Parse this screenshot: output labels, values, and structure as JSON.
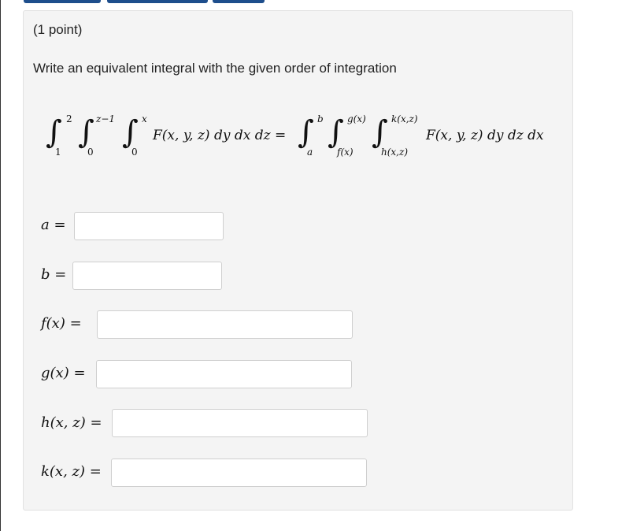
{
  "problem": {
    "points": "(1 point)",
    "prompt": "Write an equivalent integral with the given order of integration"
  },
  "equation": {
    "lhs_outer_upper": "2",
    "lhs_outer_lower": "1",
    "lhs_middle_upper": "z−1",
    "lhs_middle_lower": "0",
    "lhs_inner_upper": "x",
    "lhs_inner_lower": "0",
    "lhs_integrand": "F(x, y, z) dy dx dz =",
    "rhs_outer_upper": "b",
    "rhs_outer_lower": "a",
    "rhs_middle_upper": "g(x)",
    "rhs_middle_lower": "f(x)",
    "rhs_inner_upper": "k(x,z)",
    "rhs_inner_lower": "h(x,z)",
    "rhs_integrand": "F(x, y, z) dy dz dx"
  },
  "fields": {
    "a": {
      "label": "a =",
      "value": ""
    },
    "b": {
      "label": "b =",
      "value": ""
    },
    "f": {
      "label": "f(x) =",
      "value": ""
    },
    "g": {
      "label": "g(x) =",
      "value": ""
    },
    "h": {
      "label": "h(x, z) =",
      "value": ""
    },
    "k": {
      "label": "k(x, z) =",
      "value": ""
    }
  },
  "colors": {
    "tab_accent": "#1e4e8c",
    "panel_bg": "#f4f4f4"
  }
}
